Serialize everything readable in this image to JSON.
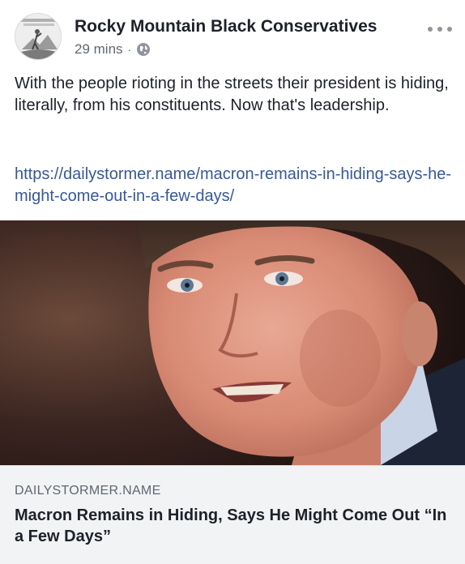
{
  "post": {
    "page_name": "Rocky Mountain Black Conservatives",
    "time": "29 mins",
    "separator": "·",
    "privacy_icon": "globe-icon",
    "more_icon": "more-options-icon",
    "avatar_icon": "page-avatar",
    "text": "With the people rioting in the streets their president is hiding, literally, from his constituents. Now that's leadership.",
    "link": "https://dailystormer.name/macron-remains-in-hiding-says-he-might-come-out-in-a-few-days/"
  },
  "link_preview": {
    "image": "portrait-photo",
    "domain": "DAILYSTORMER.NAME",
    "title": "Macron Remains in Hiding, Says He Might Come Out “In a Few Days”"
  },
  "colors": {
    "text": "#1d2129",
    "secondary": "#606770",
    "link": "#385898",
    "card_background": "#f2f3f5"
  }
}
